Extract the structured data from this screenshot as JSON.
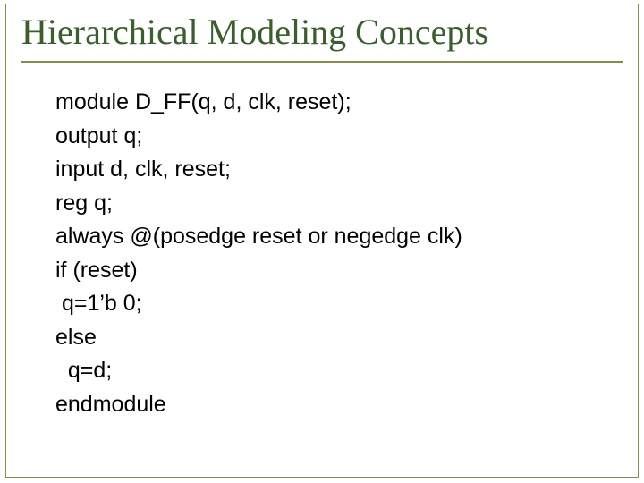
{
  "title": "Hierarchical Modeling Concepts",
  "code": {
    "l1": "module D_FF(q, d, clk, reset);",
    "l2": "output q;",
    "l3": "input d, clk, reset;",
    "l4": "reg q;",
    "l5": "always @(posedge reset or negedge clk)",
    "l6": "if (reset)",
    "l7": " q=1’b 0;",
    "l8": "else",
    "l9": "  q=d;",
    "l10": "endmodule"
  }
}
